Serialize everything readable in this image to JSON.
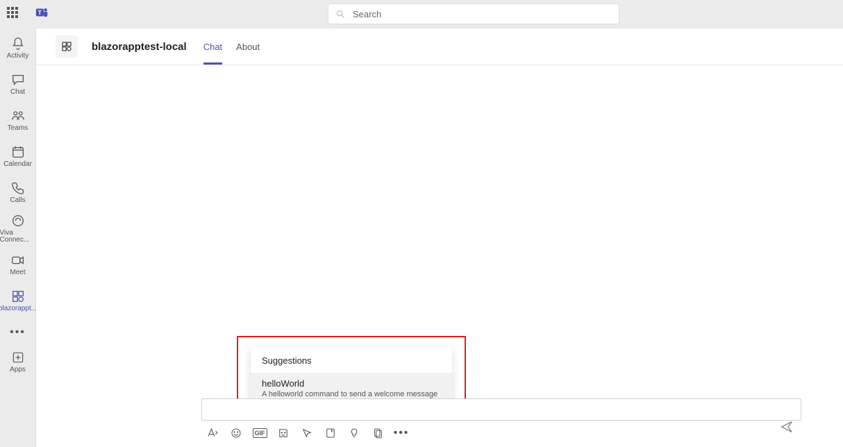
{
  "header": {
    "search_placeholder": "Search"
  },
  "rail": {
    "activity": "Activity",
    "chat": "Chat",
    "teams": "Teams",
    "calendar": "Calendar",
    "calls": "Calls",
    "viva": "Viva Connec...",
    "meet": "Meet",
    "app": "blazorappt...",
    "apps": "Apps"
  },
  "chat": {
    "title": "blazorapptest-local",
    "tabs": {
      "chat": "Chat",
      "about": "About"
    }
  },
  "suggestions": {
    "header": "Suggestions",
    "item_title": "helloWorld",
    "item_desc": "A helloworld command to send a welcome message"
  },
  "compose_toolbar": {
    "gif_label": "GIF"
  }
}
